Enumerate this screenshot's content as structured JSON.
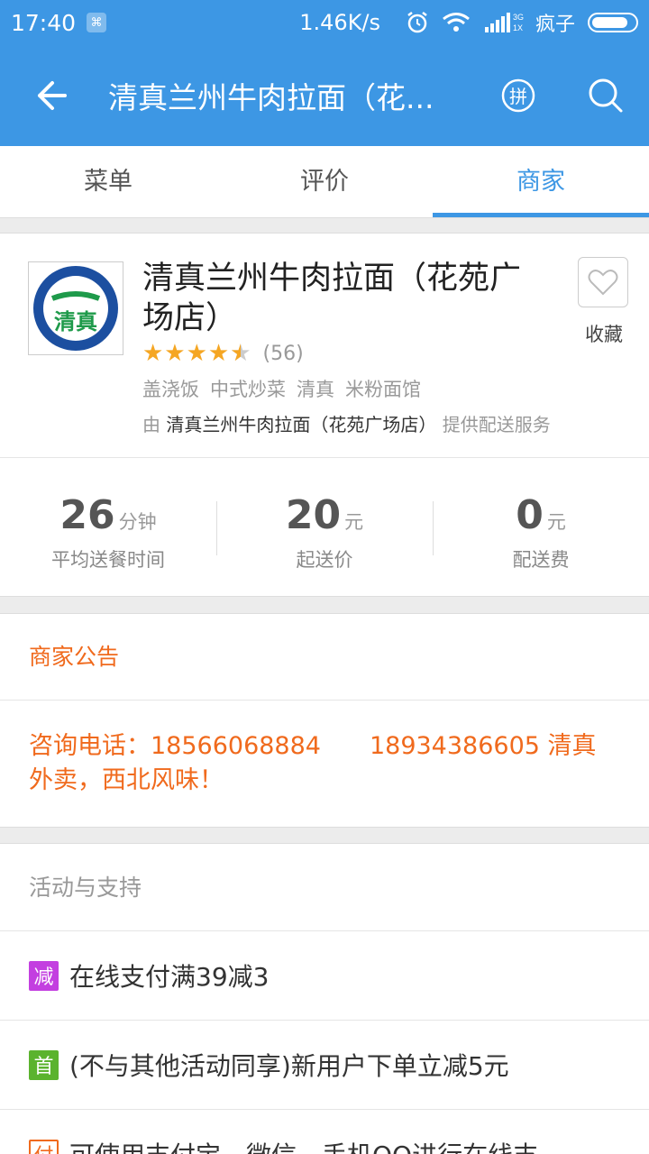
{
  "status_bar": {
    "time": "17:40",
    "network_speed": "1.46K/s",
    "signal_label": "3G 1X",
    "carrier": "疯子",
    "battery_level": 0.85
  },
  "app_bar": {
    "title": "清真兰州牛肉拉面（花...",
    "pin_icon_label": "拼"
  },
  "tabs": [
    {
      "label": "菜单",
      "active": false
    },
    {
      "label": "评价",
      "active": false
    },
    {
      "label": "商家",
      "active": true
    }
  ],
  "shop": {
    "logo_text": "清真",
    "name": "清真兰州牛肉拉面（花苑广场店）",
    "rating": 4.5,
    "rating_count": "(56)",
    "categories": [
      "盖浇饭",
      "中式炒菜",
      "清真",
      "米粉面馆"
    ],
    "delivery_prefix": "由",
    "delivery_name": "清真兰州牛肉拉面（花苑广场店）",
    "delivery_suffix": "提供配送服务",
    "favorite_label": "收藏"
  },
  "stats": [
    {
      "value": "26",
      "unit": "分钟",
      "label": "平均送餐时间"
    },
    {
      "value": "20",
      "unit": "元",
      "label": "起送价"
    },
    {
      "value": "0",
      "unit": "元",
      "label": "配送费"
    }
  ],
  "notice": {
    "title": "商家公告",
    "text": "咨询电话：18566068884　　18934386605 清真外卖，西北风味！"
  },
  "promotions": {
    "title": "活动与支持",
    "items": [
      {
        "tag": "减",
        "type": "cut",
        "text": "在线支付满39减3"
      },
      {
        "tag": "首",
        "type": "first",
        "text": "(不与其他活动同享)新用户下单立减5元"
      },
      {
        "tag": "付",
        "type": "pay",
        "text": "可使用支付宝、微信、手机QQ进行在线支"
      }
    ]
  },
  "colors": {
    "primary": "#3d97e4",
    "accent_orange": "#f06a1d",
    "star": "#f5a623",
    "tag_cut": "#c33fe0",
    "tag_first": "#5bb32e"
  }
}
